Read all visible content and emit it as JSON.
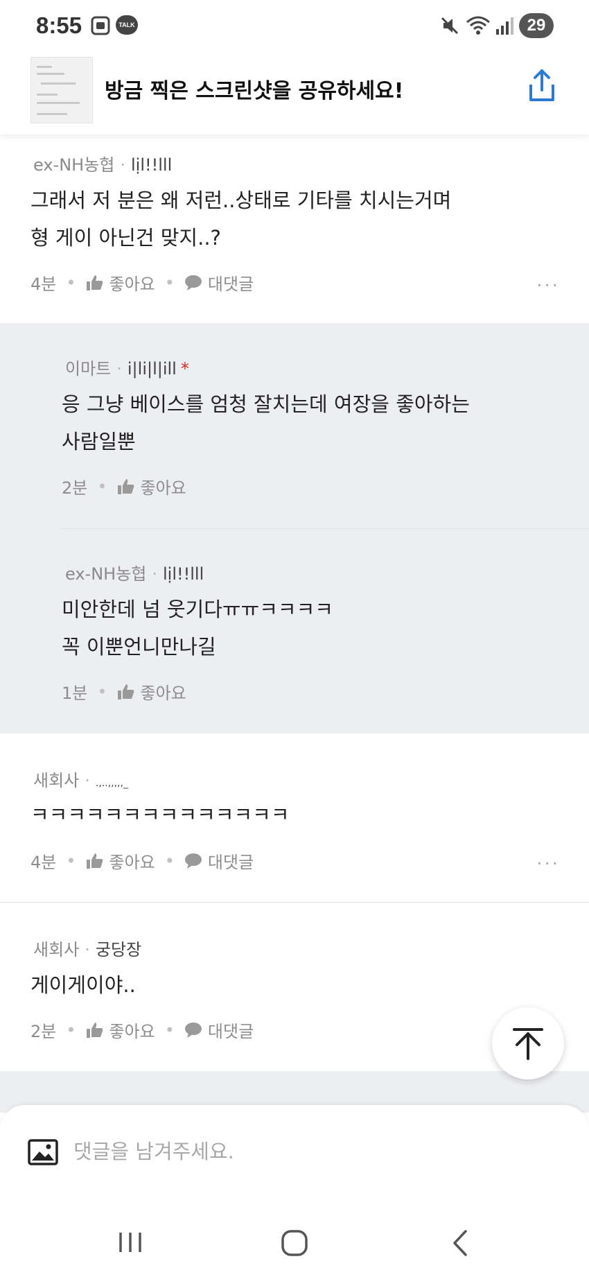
{
  "status_bar": {
    "time": "8:55",
    "left_icons": [
      "screenshot-icon",
      "kakaotalk-icon"
    ],
    "kakao_label": "TALK",
    "right_icons": [
      "mute-icon",
      "wifi-icon",
      "signal-icon"
    ],
    "battery": "29"
  },
  "share_banner": {
    "title": "방금 찍은 스크린샷을 공유하세요!"
  },
  "comments": [
    {
      "author": "ex-NH농협",
      "badge": "lịl!!lll",
      "lines": [
        "그래서 저 분은 왜 저런..상태로 기타를 치시는거며",
        "형 게이 아닌건 맞지..?"
      ],
      "time": "4분",
      "like_label": "좋아요",
      "reply_label": "대댓글",
      "more": "..."
    },
    {
      "author": "이마트",
      "badge": "i|li|l|ill",
      "star": "*",
      "lines": [
        "응 그냥 베이스를 엄청 잘치는데 여장을 좋아하는",
        "사람일뿐"
      ],
      "time": "2분",
      "like_label": "좋아요"
    },
    {
      "author": "ex-NH농협",
      "badge": "lịl!!lll",
      "lines": [
        "미안한데 넘 웃기다ㅠㅠㅋㅋㅋㅋ",
        "꼭 이뿐언니만나길"
      ],
      "time": "1분",
      "like_label": "좋아요"
    },
    {
      "author": "새회사",
      "badge": ".,..,,,,,_",
      "lines": [
        "ㅋㅋㅋㅋㅋㅋㅋㅋㅋㅋㅋㅋㅋㅋ"
      ],
      "time": "4분",
      "like_label": "좋아요",
      "reply_label": "대댓글",
      "more": "..."
    },
    {
      "author": "새회사",
      "badge": "궁당장",
      "lines": [
        "게이게이야.."
      ],
      "time": "2분",
      "like_label": "좋아요",
      "reply_label": "대댓글"
    }
  ],
  "composer": {
    "placeholder": "댓글을 남겨주세요."
  },
  "colors": {
    "reply_background": "#eceef1",
    "accent": "#2b7bd6",
    "required_star": "#e02424"
  }
}
